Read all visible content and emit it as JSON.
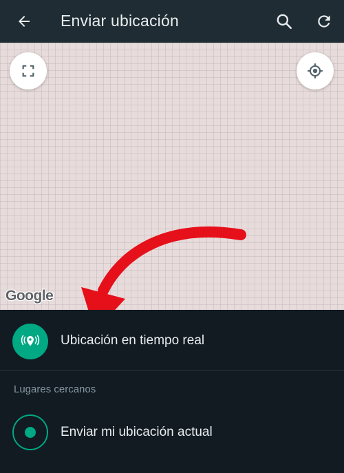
{
  "appbar": {
    "title": "Enviar ubicación",
    "icons": {
      "back": "arrow-left-icon",
      "search": "search-icon",
      "refresh": "refresh-icon"
    }
  },
  "map": {
    "attribution": "Google",
    "icons": {
      "fullscreen": "fullscreen-icon",
      "my_location": "crosshair-icon"
    }
  },
  "live_location": {
    "label": "Ubicación en tiempo real",
    "icon": "live-location-icon"
  },
  "nearby": {
    "header": "Lugares cercanos"
  },
  "current_location": {
    "label": "Enviar mi ubicación actual",
    "icon": "radio-target-icon"
  },
  "colors": {
    "accent": "#00a884",
    "appbar": "#1f2c33",
    "background": "#111b21",
    "annotation_arrow": "#e6101a"
  }
}
